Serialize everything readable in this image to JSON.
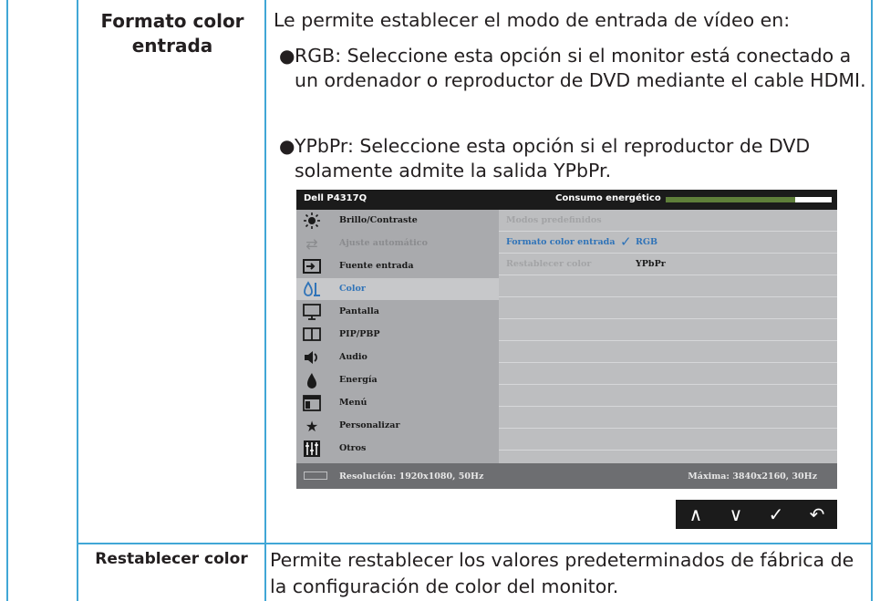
{
  "rows": [
    {
      "term": "Formato color entrada",
      "intro": "Le permite establecer el modo de entrada de vídeo en:",
      "bullets": [
        "RGB: Seleccione esta opción si el monitor está conectado a un ordenador o reproductor de DVD mediante el cable HDMI.",
        "YPbPr: Seleccione esta opción si el reproductor de DVD solamente admite la salida YPbPr."
      ]
    },
    {
      "term": "Restablecer color",
      "description": "Permite restablecer los valores predeterminados de fábrica de la configuración de color del monitor."
    }
  ],
  "osd": {
    "brand": "Dell P4317Q",
    "energy_label": "Consumo energético",
    "energy_level": 0.78,
    "energy_color": "#5f7f3a",
    "menu": [
      {
        "label": "Brillo/Contraste",
        "icon": "sun-icon"
      },
      {
        "label": "Ajuste automático",
        "icon": "auto-adjust-icon"
      },
      {
        "label": "Fuente entrada",
        "icon": "input-source-icon"
      },
      {
        "label": "Color",
        "icon": "color-icon"
      },
      {
        "label": "Pantalla",
        "icon": "display-icon"
      },
      {
        "label": "PIP/PBP",
        "icon": "pip-icon"
      },
      {
        "label": "Audio",
        "icon": "speaker-icon"
      },
      {
        "label": "Energía",
        "icon": "energy-icon"
      },
      {
        "label": "Menú",
        "icon": "menu-icon"
      },
      {
        "label": "Personalizar",
        "icon": "star-icon"
      },
      {
        "label": "Otros",
        "icon": "others-icon"
      }
    ],
    "submenu": {
      "preset_modes": "Modos predefinidos",
      "input_color_format": "Formato color entrada",
      "reset_color": "Restablecer color",
      "option_rgb": "RGB",
      "option_ypbpr": "YPbPr"
    },
    "footer_left": "Resolución: 1920x1080, 50Hz",
    "footer_right": "Máxima: 3840x2160, 30Hz",
    "accent_color": "#2f73b8"
  },
  "nav_buttons": {
    "up": "∧",
    "down": "∨",
    "check": "✓",
    "back": "↶"
  }
}
